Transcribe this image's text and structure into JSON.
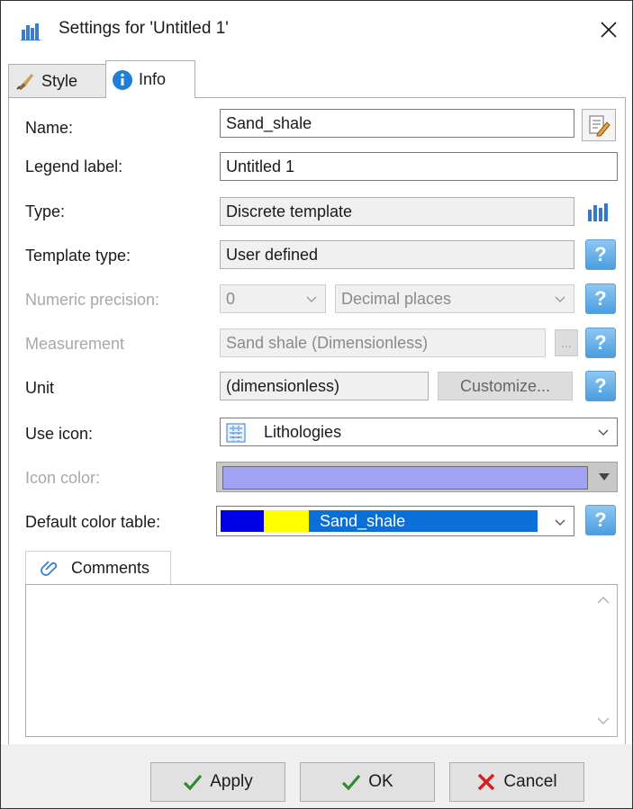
{
  "window": {
    "title": "Settings for 'Untitled 1'"
  },
  "tabs": [
    {
      "label": "Style"
    },
    {
      "label": "Info"
    }
  ],
  "form": {
    "name": {
      "label": "Name:",
      "value": "Sand_shale"
    },
    "legend_label": {
      "label": "Legend label:",
      "value": "Untitled 1"
    },
    "type": {
      "label": "Type:",
      "value": "Discrete template"
    },
    "template_type": {
      "label": "Template type:",
      "value": "User defined"
    },
    "numeric_precision": {
      "label": "Numeric precision:",
      "value": "0",
      "mode": "Decimal places"
    },
    "measurement": {
      "label": "Measurement",
      "value": "Sand shale (Dimensionless)",
      "browse_label": "..."
    },
    "unit": {
      "label": "Unit",
      "value": "(dimensionless)",
      "customize_label": "Customize..."
    },
    "use_icon": {
      "label": "Use icon:",
      "value": "Lithologies"
    },
    "icon_color": {
      "label": "Icon color:",
      "color": "#a3a3f5"
    },
    "default_color_table": {
      "label": "Default color table:",
      "value": "Sand_shale",
      "colors": [
        "#0000e6",
        "#ffff00",
        "#0a6fd6"
      ]
    }
  },
  "help_glyph": "?",
  "comments": {
    "tab_label": "Comments",
    "text": ""
  },
  "buttons": {
    "apply": "Apply",
    "ok": "OK",
    "cancel": "Cancel"
  }
}
